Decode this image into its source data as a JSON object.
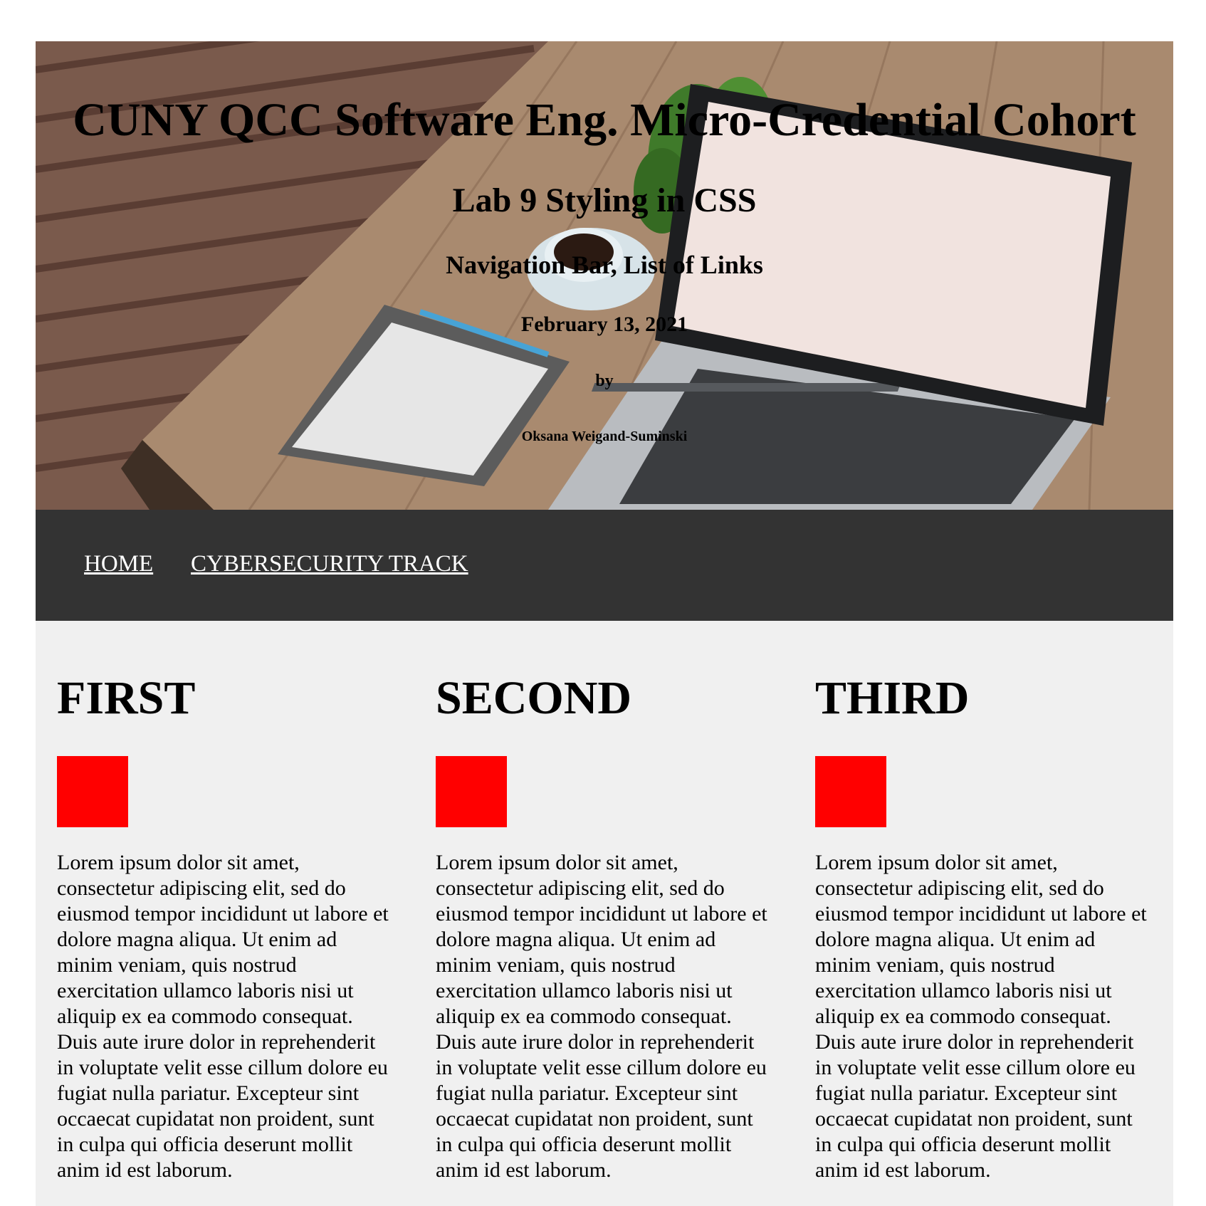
{
  "hero": {
    "title": "CUNY QCC Software Eng. Micro-Credential Cohort",
    "subtitle": "Lab 9 Styling in CSS",
    "topic": "Navigation Bar, List of Links",
    "date": "February 13, 2021",
    "by": "by",
    "author": "Oksana Weigand-Suminski",
    "image_icon": "laptop-on-desk-photo"
  },
  "nav": {
    "items": [
      {
        "label": "HOME"
      },
      {
        "label": "CYBERSECURITY TRACK"
      }
    ],
    "background": "#333333",
    "link_color": "#ffffff"
  },
  "content": {
    "background": "#f0f0f0",
    "square_color": "#ff0000",
    "columns": [
      {
        "heading": "FIRST",
        "text": "Lorem ipsum dolor sit amet, consectetur adipiscing elit, sed do eiusmod tempor incididunt ut labore et dolore magna aliqua. Ut enim ad minim veniam, quis nostrud exercitation ullamco laboris nisi ut aliquip ex ea commodo consequat. Duis aute irure dolor in reprehenderit in voluptate velit esse cillum dolore eu fugiat nulla pariatur. Excepteur sint occaecat cupidatat non proident, sunt in culpa qui officia deserunt mollit anim id est laborum."
      },
      {
        "heading": "SECOND",
        "text": "Lorem ipsum dolor sit amet, consectetur adipiscing elit, sed do eiusmod tempor incididunt ut labore et dolore magna aliqua. Ut enim ad minim veniam, quis nostrud exercitation ullamco laboris nisi ut aliquip ex ea commodo consequat. Duis aute irure dolor in reprehenderit in voluptate velit esse cillum dolore eu fugiat nulla pariatur. Excepteur sint occaecat cupidatat non proident, sunt in culpa qui officia deserunt mollit anim id est laborum."
      },
      {
        "heading": "THIRD",
        "text": "Lorem ipsum dolor sit amet, consectetur adipiscing elit, sed do eiusmod tempor incididunt ut labore et dolore magna aliqua. Ut enim ad minim veniam, quis nostrud exercitation ullamco laboris nisi ut aliquip ex ea commodo consequat. Duis aute irure dolor in reprehenderit in voluptate velit esse cillum olore eu fugiat nulla pariatur. Excepteur sint occaecat cupidatat non proident, sunt in culpa qui officia deserunt mollit anim id est laborum."
      }
    ]
  }
}
